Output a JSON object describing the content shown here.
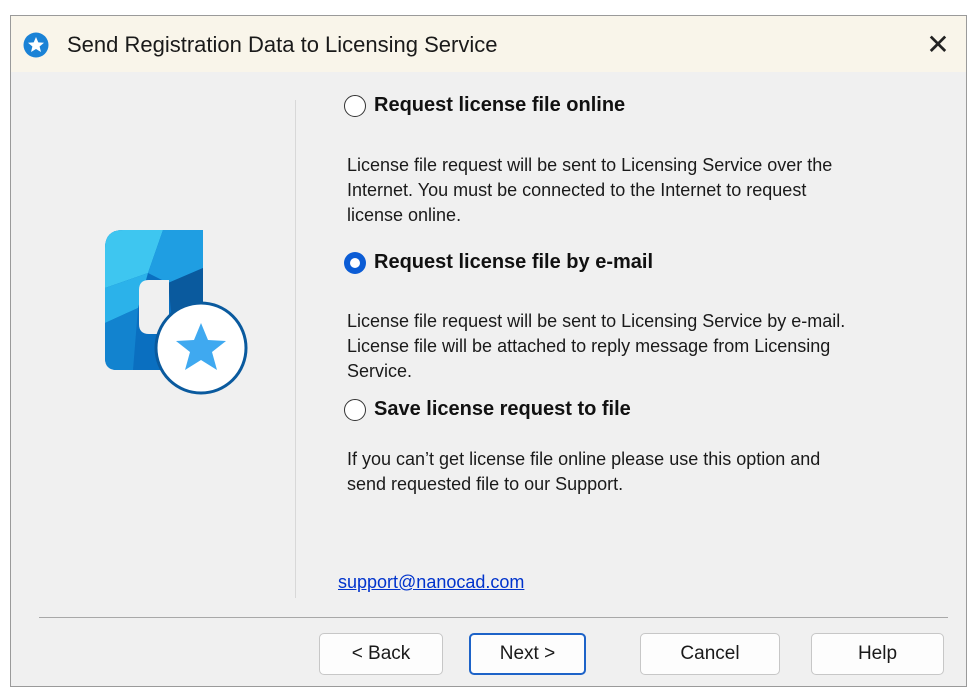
{
  "window": {
    "title": "Send Registration Data to Licensing Service",
    "close_glyph": "✕"
  },
  "options": [
    {
      "label": "Request license file online",
      "checked": false,
      "description": [
        "License file request will be sent to Licensing Service over the",
        "Internet. You must be connected to the Internet to request",
        "license online."
      ]
    },
    {
      "label": "Request license file by e-mail",
      "checked": true,
      "description": [
        "License file request will be sent to Licensing Service by e-mail.",
        "License file will be attached to reply message from Licensing",
        "Service."
      ]
    },
    {
      "label": "Save license request to file",
      "checked": false,
      "description": [
        "If you can’t get license file online please use this option and",
        "send requested file to our Support."
      ]
    }
  ],
  "support_email": "support@nanocad.com",
  "buttons": {
    "back": "< Back",
    "next": "Next >",
    "cancel": "Cancel",
    "help": "Help"
  },
  "colors": {
    "accent": "#0b5cd5",
    "link": "#0033cc",
    "titlebar": "#f9f5ea",
    "logo_light": "#3ec6f0",
    "logo_dark": "#0a5a9e"
  },
  "icons": {
    "title": "app-star-icon",
    "logo": "nanocad-license-logo-icon",
    "close": "close-icon"
  }
}
